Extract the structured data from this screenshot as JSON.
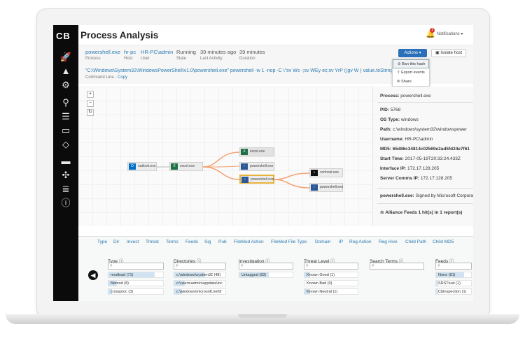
{
  "app": {
    "logo": "CB",
    "title": "Process Analysis",
    "notifications_label": "Notifications",
    "notification_count": "1"
  },
  "process_meta": [
    {
      "value": "powershell.exe",
      "label": "Process"
    },
    {
      "value": "hr-pc",
      "label": "Host"
    },
    {
      "value": "HR-PC\\admin",
      "label": "User"
    },
    {
      "value": "Running",
      "label": "State"
    },
    {
      "value": "39 minutes ago",
      "label": "Last Activity"
    },
    {
      "value": "39 minutes",
      "label": "Duration"
    }
  ],
  "toolbar": {
    "actions_label": "Actions",
    "isolate_label": "Isolate host"
  },
  "actions_menu": [
    "Ban this hash",
    "Export events",
    "Share"
  ],
  "command_line": {
    "text": "\"C:\\Windows\\System32\\WindowsPowerShell\\v1.0\\powershell.exe\" powershell -w 1 -nop -C \\\"sv Ws -;sv WEy ec;sv YrP ((gv W                 ) value.toString()),(po",
    "label": "Command Line",
    "copy_label": "Copy"
  },
  "graph": {
    "zoom_in": "+",
    "zoom_out": "−",
    "reset": "↻",
    "nodes": {
      "outlook": "outlook.exe",
      "excel_parent": "excel.exe",
      "excel_child": "excel.exe",
      "powershell_1": "powershell.exe",
      "powershell_2": "powershell.exe",
      "conhost": "conhost.exe",
      "powershell_3": "powershell.exe"
    }
  },
  "details": {
    "process": {
      "label": "Process:",
      "value": "powershell.exe"
    },
    "pid": {
      "label": "PID:",
      "value": "5768"
    },
    "os_type": {
      "label": "OS Type:",
      "value": "windows"
    },
    "path": {
      "label": "Path:",
      "value": "c:\\windows\\system32\\windowspower"
    },
    "username": {
      "label": "Username:",
      "value": "HR-PC\\admin"
    },
    "md5": {
      "label": "MD5:",
      "value": "65d86c34814c02569e2ad5fd24e7f61"
    },
    "start_time": {
      "label": "Start Time:",
      "value": "2017-05-19T20:33:24.433Z"
    },
    "interface_ip": {
      "label": "Interface IP:",
      "value": "172.17.128.205"
    },
    "server_comms_ip": {
      "label": "Server Comms IP:",
      "value": "172.17.128.205"
    },
    "signature": {
      "label": "powershell.exe:",
      "value": "Signed by Microsoft Corpora"
    },
    "alliance": "Alliance Feeds 1 hit(s) in 1 report(s)"
  },
  "facet_tabs": [
    "Type",
    "Dir",
    "Invest",
    "Threat",
    "Terms",
    "Feeds",
    "Sig",
    "Pub",
    "FileMod Action",
    "FileMod File Type",
    "Domain",
    "IP",
    "Reg Action",
    "Reg Hive",
    "Child Path",
    "Child MD5"
  ],
  "facets": [
    {
      "title": "Type",
      "items": [
        {
          "label": "modload (71)",
          "fill": 0.85
        },
        {
          "label": "filemod (8)",
          "fill": 0.15
        },
        {
          "label": "crossproc (3)",
          "fill": 0.06
        }
      ]
    },
    {
      "title": "Directories",
      "items": [
        {
          "label": "c:\\windows\\system32 (48)",
          "fill": 0.6
        },
        {
          "label": "c:\\users\\admin\\appdata\\loc",
          "fill": 0.2
        },
        {
          "label": "c:\\windows\\microsoft.net\\fr",
          "fill": 0.15
        }
      ]
    },
    {
      "title": "Investigation",
      "items": [
        {
          "label": "Untagged (83)",
          "fill": 0.55
        }
      ]
    },
    {
      "title": "Threat Level",
      "items": [
        {
          "label": "Known Good (1)",
          "fill": 0.1
        },
        {
          "label": "Known Bad (0)",
          "fill": 0.0
        },
        {
          "label": "Known Neutral (1)",
          "fill": 0.1
        }
      ]
    },
    {
      "title": "Search Terms",
      "items": []
    },
    {
      "title": "Feeds",
      "items": [
        {
          "label": "None (81)",
          "fill": 0.8
        },
        {
          "label": "SRSTrust (1)",
          "fill": 0.05
        },
        {
          "label": "CbInspection (1)",
          "fill": 0.05
        }
      ]
    }
  ],
  "icons": {
    "sidebar": [
      "rocket-icon",
      "warning-icon",
      "gear-icon",
      "search-icon",
      "list-icon",
      "terminal-icon",
      "tag-icon",
      "monitor-icon",
      "network-icon",
      "server-icon",
      "alert-circle-icon"
    ],
    "colors": {
      "accent": "#2a6fb8",
      "link": "#2a7ab0",
      "sidebar": "#0b0b0b",
      "highlight": "#e8b23a",
      "excel": "#1e7145",
      "powershell": "#2b5797",
      "outlook": "#0072c6"
    }
  }
}
